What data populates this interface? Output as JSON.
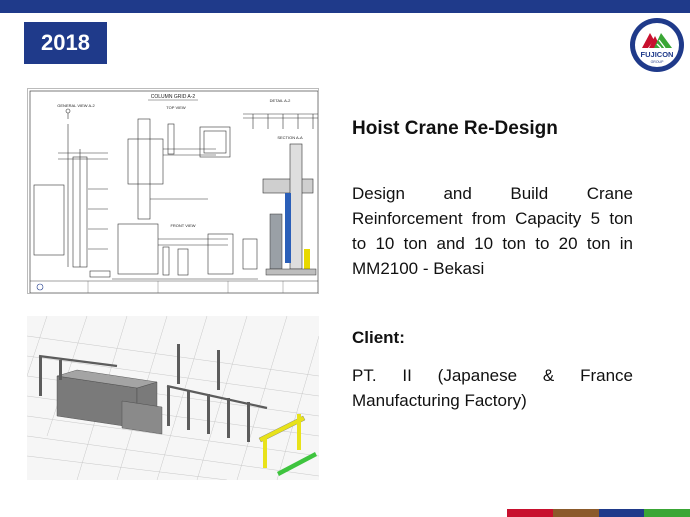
{
  "year": "2018",
  "logo": {
    "brand": "FUJICON",
    "tagline": "GROUP",
    "colors": {
      "ring": "#1f3a8a",
      "red": "#c8102e",
      "green": "#3aa635"
    }
  },
  "project": {
    "title": "Hoist Crane Re-Design",
    "description": "Design and Build Crane Reinforcement from Capacity 5 ton to 10 ton and 10 ton to 20 ton in MM2100 - Bekasi",
    "client_label": "Client:",
    "client": "PT. II (Japanese & France Manufacturing Factory)"
  },
  "drawing": {
    "sheet_title": "COLUMN GRID A-2",
    "views": [
      "GENERAL VIEW A-2",
      "TOP VIEW",
      "SECTION A-A",
      "DETAIL A-2",
      "FRONT VIEW"
    ]
  },
  "colors": {
    "accent": "#1f3a8a",
    "footer": [
      "#c8102e",
      "#8b5a2b",
      "#1f3a8a",
      "#3aa635"
    ]
  }
}
